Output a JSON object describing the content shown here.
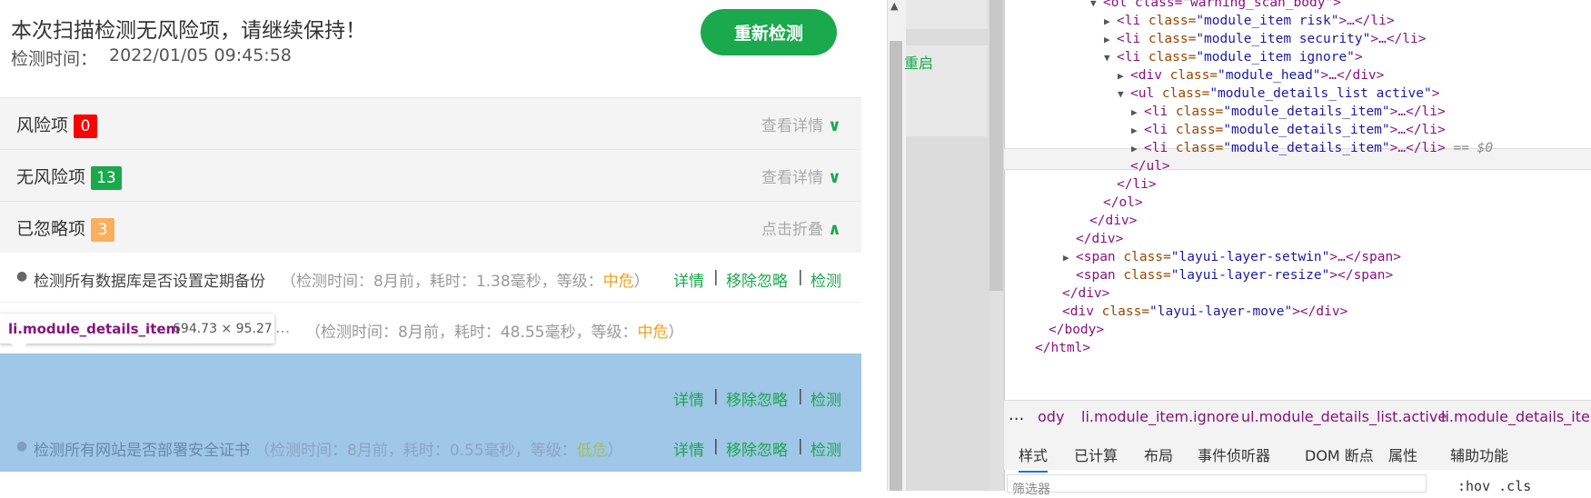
{
  "scan": {
    "title": "本次扫描检测无风险项，请继续保持！",
    "time_label": "检测时间：",
    "time_value": "2022/01/05 09:45:58",
    "rescan_label": "重新检测"
  },
  "sections": [
    {
      "label": "风险项",
      "count": "0",
      "action": "查看详情",
      "chevron": "∨"
    },
    {
      "label": "无风险项",
      "count": "13",
      "action": "查看详情",
      "chevron": "∨"
    },
    {
      "label": "已忽略项",
      "count": "3",
      "action": "点击折叠",
      "chevron": "∧"
    }
  ],
  "items": [
    {
      "name": "检测所有数据库是否设置定期备份",
      "meta_prefix": "（检测时间：8月前，耗时：1.38毫秒，等级：",
      "level": "中危",
      "meta_suffix": "）"
    },
    {
      "name": "",
      "meta_prefix": "（检测时间：8月前，耗时：48.55毫秒，等级：",
      "level": "中危",
      "meta_suffix": "）"
    },
    {
      "name": "检测所有网站是否部署安全证书",
      "meta_prefix": "（检测时间：8月前，耗时：0.55毫秒，等级：",
      "level": "低危",
      "meta_suffix": "）"
    }
  ],
  "item_links": {
    "detail": "详情",
    "unignore": "移除忽略",
    "check": "检测",
    "sep": "|"
  },
  "tooltip": {
    "tag": "li.module_details_item",
    "size": "694.73 × 95.27",
    "dots": "..."
  },
  "background_page": {
    "restart": "重启"
  },
  "devtools": {
    "dom_lines": [
      {
        "indent": 6,
        "tri": "▶",
        "open": "<li ",
        "attr": "class=",
        "val": "\"module_item risk\"",
        "rest": ">…</li>"
      },
      {
        "indent": 6,
        "tri": "▶",
        "open": "<li ",
        "attr": "class=",
        "val": "\"module_item security\"",
        "rest": ">…</li>"
      },
      {
        "indent": 6,
        "tri": "▼",
        "open": "<li ",
        "attr": "class=",
        "val": "\"module_item ignore\"",
        "rest": ">"
      },
      {
        "indent": 7,
        "tri": "▶",
        "open": "<div ",
        "attr": "class=",
        "val": "\"module_head\"",
        "rest": ">…</div>"
      },
      {
        "indent": 7,
        "tri": "▼",
        "open": "<ul ",
        "attr": "class=",
        "val": "\"module_details_list  active\"",
        "rest": ">"
      },
      {
        "indent": 8,
        "tri": "▶",
        "open": "<li ",
        "attr": "class=",
        "val": "\"module_details_item\"",
        "rest": ">…</li>"
      },
      {
        "indent": 8,
        "tri": "▶",
        "open": "<li ",
        "attr": "class=",
        "val": "\"module_details_item\"",
        "rest": ">…</li>"
      },
      {
        "indent": 8,
        "tri": "▶",
        "open": "<li ",
        "attr": "class=",
        "val": "\"module_details_item\"",
        "rest": ">…</li>",
        "selected": true,
        "eq": "== $0"
      },
      {
        "indent": 7,
        "tri": "",
        "open": "</ul>",
        "attr": "",
        "val": "",
        "rest": ""
      },
      {
        "indent": 6,
        "tri": "",
        "open": "</li>",
        "attr": "",
        "val": "",
        "rest": ""
      },
      {
        "indent": 5,
        "tri": "",
        "open": "</ol>",
        "attr": "",
        "val": "",
        "rest": ""
      },
      {
        "indent": 4,
        "tri": "",
        "open": "</div>",
        "attr": "",
        "val": "",
        "rest": ""
      },
      {
        "indent": 3,
        "tri": "",
        "open": "</div>",
        "attr": "",
        "val": "",
        "rest": ""
      },
      {
        "indent": 3,
        "tri": "▶",
        "open": "<span ",
        "attr": "class=",
        "val": "\"layui-layer-setwin\"",
        "rest": ">…</span>"
      },
      {
        "indent": 3,
        "tri": "",
        "open": "<span ",
        "attr": "class=",
        "val": "\"layui-layer-resize\"",
        "rest": "></span>"
      },
      {
        "indent": 2,
        "tri": "",
        "open": "</div>",
        "attr": "",
        "val": "",
        "rest": ""
      },
      {
        "indent": 2,
        "tri": "",
        "open": "<div ",
        "attr": "class=",
        "val": "\"layui-layer-move\"",
        "rest": "></div>"
      },
      {
        "indent": 1,
        "tri": "",
        "open": "</body>",
        "attr": "",
        "val": "",
        "rest": ""
      },
      {
        "indent": 0,
        "tri": "",
        "open": "</html>",
        "attr": "",
        "val": "",
        "rest": ""
      }
    ],
    "top_partial": "<ol class=\"warning_scan_body\">",
    "breadcrumbs": [
      "...",
      "ody",
      "li.module_item.ignore",
      "ul.module_details_list.active",
      "li.module_details_item"
    ],
    "subtabs": [
      "样式",
      "已计算",
      "布局",
      "事件侦听器",
      "DOM 断点",
      "属性",
      "辅助功能"
    ],
    "filter_placeholder": "筛选器",
    "filter_extra": ":hov .cls"
  }
}
